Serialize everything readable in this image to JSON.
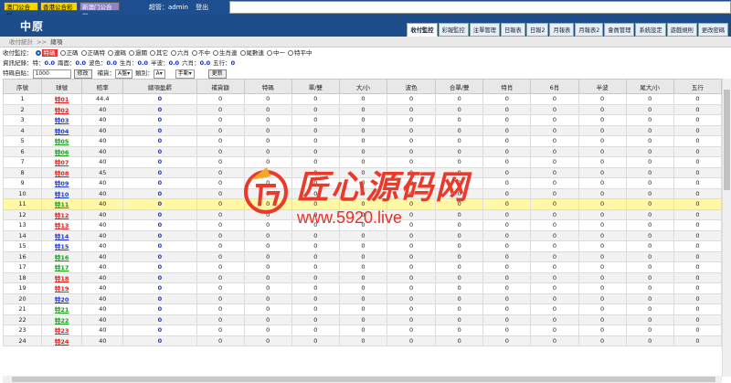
{
  "top": {
    "lotteries": [
      "澳门公合彩",
      "香港公合彩",
      "新澳门公合彩"
    ],
    "admin_label": "超管：admin",
    "logout": "登出"
  },
  "brand": "中原",
  "nav_tabs": [
    "收付監控",
    "彩報監控",
    "注單管理",
    "日報表",
    "日報2",
    "月報表",
    "月報表2",
    "會員管理",
    "系統設定",
    "遊戲規則",
    "更改密碼"
  ],
  "breadcrumb": {
    "parent": "收付統計",
    "sep": ">>",
    "current": "總項"
  },
  "filters": {
    "monitor_label": "收付監控：",
    "monitor_options": [
      "特碼",
      "正碼",
      "正碼特",
      "連碼",
      "過關",
      "其它",
      "六肖",
      "不中",
      "生肖連",
      "尾數連",
      "中一",
      "特平中"
    ],
    "selected_option": "特碼",
    "info_label": "資訊紀錄：",
    "info_items": [
      {
        "label": "特：",
        "value": "0.0"
      },
      {
        "label": "兩面：",
        "value": "0.0"
      },
      {
        "label": "波色：",
        "value": "0.0"
      },
      {
        "label": "生肖：",
        "value": "0.0"
      },
      {
        "label": "半波：",
        "value": "0.0"
      },
      {
        "label": "六肖：",
        "value": "0.0"
      },
      {
        "label": "五行：",
        "value": "0"
      }
    ],
    "self_label": "特碼自貼：",
    "self_value": "1000",
    "modify_button": "修改",
    "bet_label": "補貨：",
    "bet_value": "A盤",
    "category_label": "類別：",
    "category_value": "A",
    "manual_value": "手動",
    "update_button": "更新"
  },
  "table": {
    "headers": [
      "序號",
      "球號",
      "賠率",
      "總項盈虧",
      "補貨額",
      "特碼",
      "單/雙",
      "大/小",
      "波色",
      "合單/雙",
      "特肖",
      "6肖",
      "半波",
      "尾大/小",
      "五行"
    ],
    "rows": [
      [
        "1",
        "特01",
        "44.4",
        "0"
      ],
      [
        "2",
        "特02",
        "40",
        "0"
      ],
      [
        "3",
        "特03",
        "40",
        "0"
      ],
      [
        "4",
        "特04",
        "40",
        "0"
      ],
      [
        "5",
        "特05",
        "40",
        "0"
      ],
      [
        "6",
        "特06",
        "40",
        "0"
      ],
      [
        "7",
        "特07",
        "40",
        "0"
      ],
      [
        "8",
        "特08",
        "45",
        "0"
      ],
      [
        "9",
        "特09",
        "40",
        "0"
      ],
      [
        "10",
        "特10",
        "40",
        "0"
      ],
      [
        "11",
        "特11",
        "40",
        "0"
      ],
      [
        "12",
        "特12",
        "40",
        "0"
      ],
      [
        "13",
        "特13",
        "40",
        "0"
      ],
      [
        "14",
        "特14",
        "40",
        "0"
      ],
      [
        "15",
        "特15",
        "40",
        "0"
      ],
      [
        "16",
        "特16",
        "40",
        "0"
      ],
      [
        "17",
        "特17",
        "40",
        "0"
      ],
      [
        "18",
        "特18",
        "40",
        "0"
      ],
      [
        "19",
        "特19",
        "40",
        "0"
      ],
      [
        "20",
        "特20",
        "40",
        "0"
      ],
      [
        "21",
        "特21",
        "40",
        "0"
      ],
      [
        "22",
        "特22",
        "40",
        "0"
      ],
      [
        "23",
        "特23",
        "40",
        "0"
      ],
      [
        "24",
        "特24",
        "40",
        "0"
      ]
    ],
    "ball_colors": [
      "red",
      "red",
      "blue",
      "blue",
      "green",
      "green",
      "red",
      "red",
      "blue",
      "blue",
      "green",
      "red",
      "red",
      "blue",
      "blue",
      "green",
      "green",
      "red",
      "red",
      "blue",
      "green",
      "green",
      "red",
      "red"
    ],
    "zero": "0",
    "highlight_row": 11
  },
  "watermark": {
    "text": "匠心源码网",
    "url": "www.5920.live"
  },
  "colors": {
    "navbar": "#1c4d89",
    "red_ball": "#e02020",
    "blue_ball": "#1e3ad6",
    "green_ball": "#17a21b",
    "highlight": "#fff9a6"
  }
}
